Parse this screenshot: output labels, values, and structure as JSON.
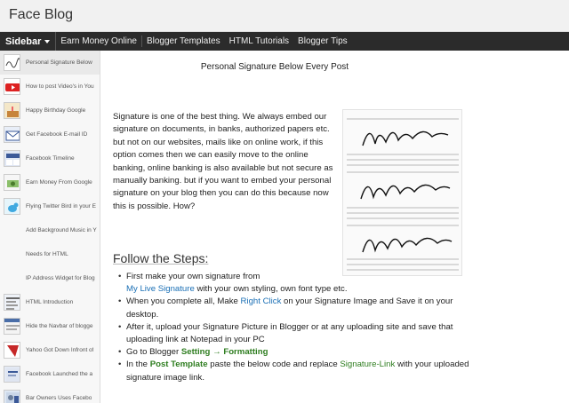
{
  "header": {
    "blog_title": "Face Blog"
  },
  "nav": {
    "sidebar_label": "Sidebar",
    "links": [
      "Earn Money Online",
      "Blogger Templates",
      "HTML Tutorials",
      "Blogger Tips"
    ]
  },
  "sidebar": {
    "items": [
      {
        "label": "Personal Signature Below",
        "icon": "signature-thumbnail-icon"
      },
      {
        "label": "How to post Video's in You",
        "icon": "youtube-thumbnail-icon"
      },
      {
        "label": "Happy Birthday Google",
        "icon": "birthday-thumbnail-icon"
      },
      {
        "label": "Get Facebook E-mail ID",
        "icon": "email-thumbnail-icon"
      },
      {
        "label": "Facebook Timeline",
        "icon": "timeline-thumbnail-icon"
      },
      {
        "label": "Earn Money From Google",
        "icon": "money-thumbnail-icon"
      },
      {
        "label": "Flying Twitter Bird in your E",
        "icon": "twitter-bird-thumbnail-icon"
      },
      {
        "label": "Add Background Music in Y",
        "icon": "music-thumbnail-icon"
      },
      {
        "label": "Needs for HTML",
        "icon": "html-thumbnail-icon"
      },
      {
        "label": "IP Address Widget for Blog",
        "icon": "ip-widget-thumbnail-icon"
      },
      {
        "label": "HTML Introduction",
        "icon": "html-intro-thumbnail-icon"
      },
      {
        "label": "Hide the Navbar of blogge",
        "icon": "navbar-thumbnail-icon"
      },
      {
        "label": "Yahoo Got Down Infront of",
        "icon": "yahoo-thumbnail-icon"
      },
      {
        "label": "Facebook Launched the a",
        "icon": "facebook-thumbnail-icon"
      },
      {
        "label": "Bar Owners Uses Facebo",
        "icon": "bar-thumbnail-icon"
      }
    ]
  },
  "post": {
    "title": "Personal Signature Below Every Post",
    "intro": "Signature is one of the best thing. We always embed our signature on documents, in banks, authorized papers etc. but not on our websites, mails like on online work, if this option comes then we can easily move to the online banking, online banking is also available but not secure as manually banking. but if you want to embed your personal signature on your blog then you can do this because now this is possible. How?",
    "steps_heading": "Follow the Steps:",
    "step1": {
      "text_a": "First make your own signature from",
      "link": "My Live Signature",
      "text_b": "with your own styling, own font type etc."
    },
    "step2": {
      "text_a": "When you complete all, Make",
      "link": "Right Click",
      "text_b": "on your Signature Image and Save it on your desktop."
    },
    "step3": {
      "text": "After it, upload your Signature Picture in Blogger or at any uploading site and save that uploading link at Notepad in your PC"
    },
    "step4": {
      "text_a": "Go to Blogger",
      "setting": "Setting",
      "arrow": "→",
      "formatting": "Formatting"
    },
    "step5": {
      "text_a": "In the",
      "template": "Post Template",
      "text_b": "paste the below code and replace",
      "sig_link": "Signature-Link",
      "text_c": "with your uploaded signature image link."
    }
  },
  "colors": {
    "link": "#1a6fb5",
    "highlight_green": "#2e7d1f",
    "nav_bg": "#2b2b2b"
  }
}
